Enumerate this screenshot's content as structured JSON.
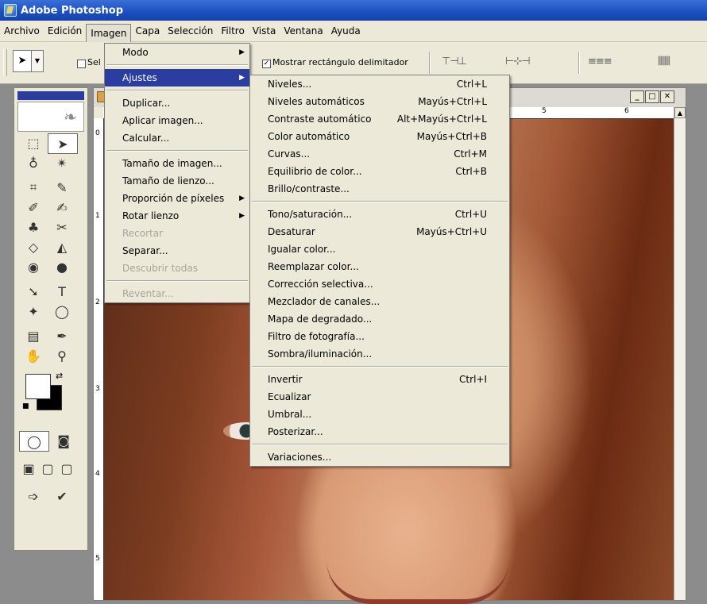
{
  "window": {
    "title": "Adobe Photoshop"
  },
  "menubar": [
    "Archivo",
    "Edición",
    "Imagen",
    "Capa",
    "Selección",
    "Filtro",
    "Vista",
    "Ventana",
    "Ayuda"
  ],
  "options": {
    "partial_label": "Sel",
    "show_bounds_label": "Mostrar rectángulo delimitador",
    "align_icons_1": "⊤⊣⊥",
    "align_icons_2": "⊢⊹⊣",
    "align_icons_3": "≡≡≡",
    "align_icons_4": "⫼⫼⫼"
  },
  "ruler": {
    "top_labels": [
      "5",
      "6"
    ],
    "left_labels": [
      "0",
      "1",
      "2",
      "3",
      "4",
      "5"
    ]
  },
  "doc_buttons": {
    "minimize": "_",
    "maximize": "□",
    "close": "✕"
  },
  "imagen_menu": [
    {
      "label": "Modo",
      "submenu": true
    },
    {
      "sep": true
    },
    {
      "label": "Ajustes",
      "submenu": true,
      "highlight": true
    },
    {
      "sep": true
    },
    {
      "label": "Duplicar..."
    },
    {
      "label": "Aplicar imagen..."
    },
    {
      "label": "Calcular..."
    },
    {
      "sep": true
    },
    {
      "label": "Tamaño de imagen..."
    },
    {
      "label": "Tamaño de lienzo..."
    },
    {
      "label": "Proporción de píxeles",
      "submenu": true
    },
    {
      "label": "Rotar lienzo",
      "submenu": true
    },
    {
      "label": "Recortar",
      "disabled": true
    },
    {
      "label": "Separar..."
    },
    {
      "label": "Descubrir todas",
      "disabled": true
    },
    {
      "sep": true
    },
    {
      "label": "Reventar...",
      "disabled": true
    }
  ],
  "ajustes_menu": [
    {
      "label": "Niveles...",
      "shortcut": "Ctrl+L"
    },
    {
      "label": "Niveles automáticos",
      "shortcut": "Mayús+Ctrl+L"
    },
    {
      "label": "Contraste automático",
      "shortcut": "Alt+Mayús+Ctrl+L"
    },
    {
      "label": "Color automático",
      "shortcut": "Mayús+Ctrl+B"
    },
    {
      "label": "Curvas...",
      "shortcut": "Ctrl+M"
    },
    {
      "label": "Equilibrio de color...",
      "shortcut": "Ctrl+B"
    },
    {
      "label": "Brillo/contraste..."
    },
    {
      "sep": true
    },
    {
      "label": "Tono/saturación...",
      "shortcut": "Ctrl+U"
    },
    {
      "label": "Desaturar",
      "shortcut": "Mayús+Ctrl+U"
    },
    {
      "label": "Igualar color..."
    },
    {
      "label": "Reemplazar color..."
    },
    {
      "label": "Corrección selectiva..."
    },
    {
      "label": "Mezclador de canales..."
    },
    {
      "label": "Mapa de degradado..."
    },
    {
      "label": "Filtro de fotografía..."
    },
    {
      "label": "Sombra/iluminación..."
    },
    {
      "sep": true
    },
    {
      "label": "Invertir",
      "shortcut": "Ctrl+I"
    },
    {
      "label": "Ecualizar"
    },
    {
      "label": "Umbral..."
    },
    {
      "label": "Posterizar..."
    },
    {
      "sep": true
    },
    {
      "label": "Variaciones..."
    }
  ],
  "tools": [
    [
      "⬚",
      "➤"
    ],
    [
      "♁",
      "✴"
    ],
    [
      "⌗",
      "✎"
    ],
    [
      "✐",
      "✍"
    ],
    [
      "♣",
      "✂"
    ],
    [
      "◇",
      "◭"
    ],
    [
      "◉",
      "●"
    ],
    [
      "➘",
      "T"
    ],
    [
      "✦",
      "◯"
    ],
    [
      "▤",
      "✒"
    ],
    [
      "✋",
      "⚲"
    ]
  ],
  "colors": {
    "accent": "#2b3e9f",
    "menu_bg": "#ece9d8",
    "title_bg": "#1b4fc0"
  }
}
